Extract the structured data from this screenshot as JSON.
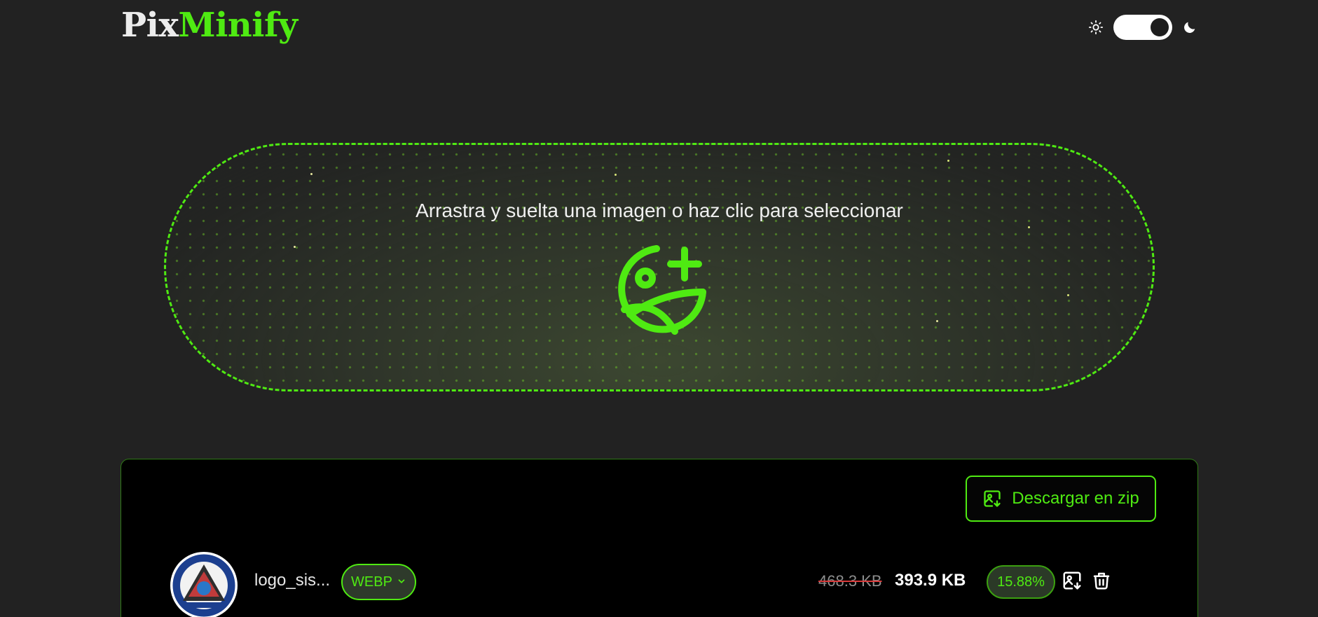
{
  "brand": {
    "part1": "Pix",
    "part2": "Minify"
  },
  "theme_toggle": {
    "light_icon": "sun-icon",
    "dark_icon": "moon-icon",
    "state": "dark"
  },
  "dropzone": {
    "text": "Arrastra y suelta una imagen o haz clic para seleccionar",
    "icon": "image-add-icon"
  },
  "panel": {
    "download_zip_label": "Descargar en zip",
    "files": [
      {
        "name": "logo_sis...",
        "format": "WEBP",
        "original_size": "468.3 KB",
        "compressed_size": "393.9 KB",
        "reduction": "15.88%"
      }
    ]
  },
  "colors": {
    "accent": "#4fea12",
    "background": "#222222",
    "panel": "#000000"
  }
}
